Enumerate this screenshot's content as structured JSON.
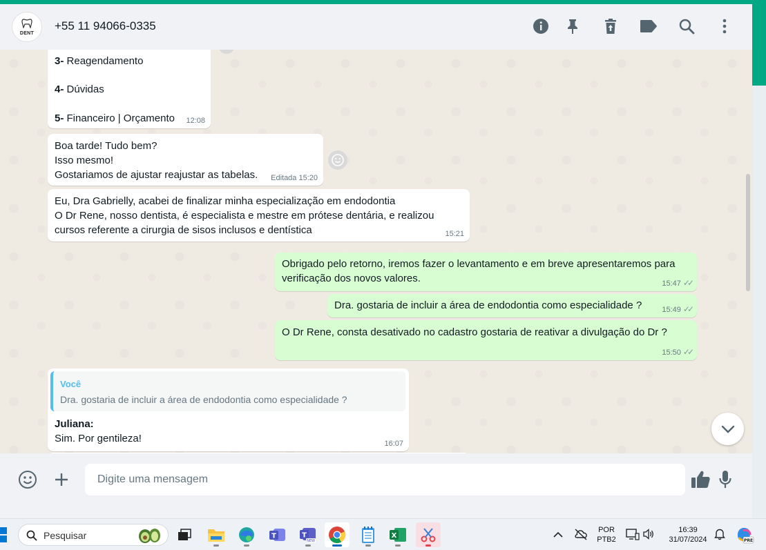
{
  "header": {
    "avatar_text": "DENT",
    "contact": "+55 11 94066-0335",
    "icons": [
      "info-icon",
      "pin-icon",
      "delete-icon",
      "label-icon",
      "search-icon",
      "more-icon"
    ]
  },
  "messages": {
    "menu": {
      "items": [
        {
          "num": "3-",
          "text": "Reagendamento"
        },
        {
          "num": "4-",
          "text": "Dúvidas"
        },
        {
          "num": "5-",
          "text": "Financeiro | Orçamento"
        }
      ],
      "time": "12:08"
    },
    "m1": {
      "lines": [
        "Boa tarde! Tudo bem?",
        "Isso mesmo!",
        "Gostariamos de ajustar reajustar as tabelas."
      ],
      "time": "Editada 15:20"
    },
    "m2": {
      "lines": [
        "Eu, Dra Gabrielly, acabei de finalizar minha especialização em endodontia",
        "O Dr Rene, nosso dentista, é especialista e mestre em prótese dentária, e realizou",
        "cursos referente a cirurgia de sisos inclusos e dentística"
      ],
      "time": "15:21"
    },
    "o1": {
      "lines": [
        "Obrigado pelo retorno, iremos fazer o levantamento e em breve apresentaremos para",
        "verificação dos novos valores."
      ],
      "time": "15:47"
    },
    "o2": {
      "text": "Dra. gostaria de incluir a área de endodontia como especialidade ?",
      "time": "15:49"
    },
    "o3": {
      "text": "O Dr Rene, consta desativado no cadastro gostaria de reativar a divulgação do Dr ?",
      "time": "15:50"
    },
    "reply": {
      "quote_author": "Você",
      "quote_text": "Dra. gostaria de incluir a área de endodontia como especialidade ?",
      "sender": "Juliana:",
      "text": "Sim. Por gentileza!",
      "time": "16:07"
    }
  },
  "footer": {
    "placeholder": "Digite uma mensagem"
  },
  "taskbar": {
    "search_label": "Pesquisar",
    "lang_top": "POR",
    "lang_bottom": "PTB2",
    "clock_time": "16:39",
    "clock_date": "31/07/2024"
  },
  "colors": {
    "accent": "#00a884",
    "outgoing": "#d9fdd3",
    "incoming": "#ffffff",
    "quote_bar": "#53bdeb"
  }
}
